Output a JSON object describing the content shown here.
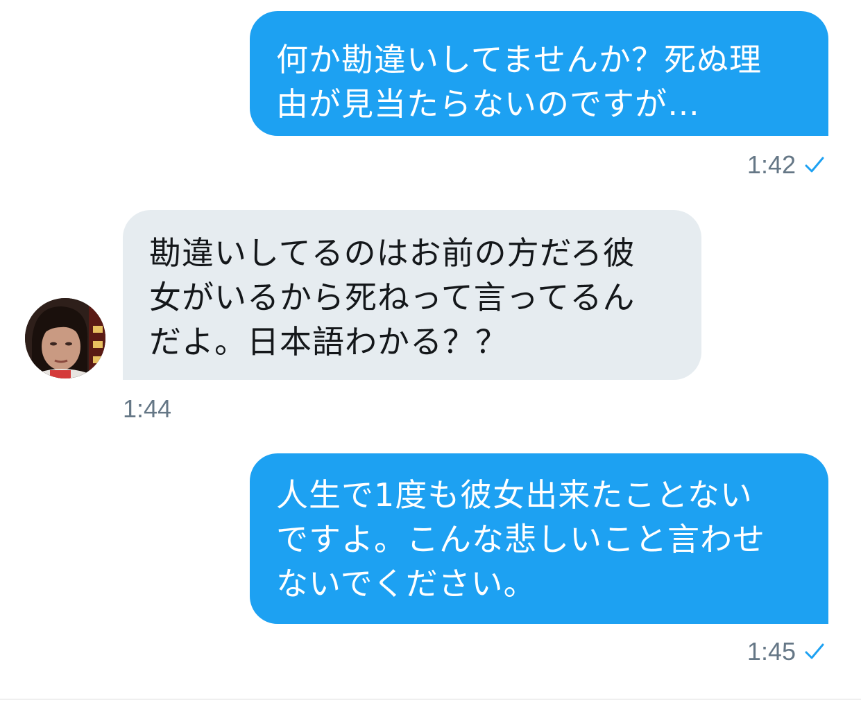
{
  "messages": [
    {
      "direction": "sent",
      "text": "何か勘違いしてませんか？死ぬ理\n由が見当たらないのですが…",
      "time": "1:42",
      "read": true
    },
    {
      "direction": "received",
      "text": "勘違いしてるのはお前の方だろ彼\n女がいるから死ねって言ってるん\nだよ。日本語わかる？？",
      "time": "1:44"
    },
    {
      "direction": "sent",
      "text": "人生で1度も彼女出来たことない\nですよ。こんな悲しいこと言わせ\nないでください。",
      "time": "1:45",
      "read": true
    }
  ],
  "colors": {
    "sent_bubble": "#1da1f2",
    "received_bubble": "#e6ecf0",
    "timestamp": "#657786",
    "check": "#1da1f2"
  },
  "icons": {
    "read_receipt": "checkmark-icon",
    "sender_avatar": "avatar"
  }
}
